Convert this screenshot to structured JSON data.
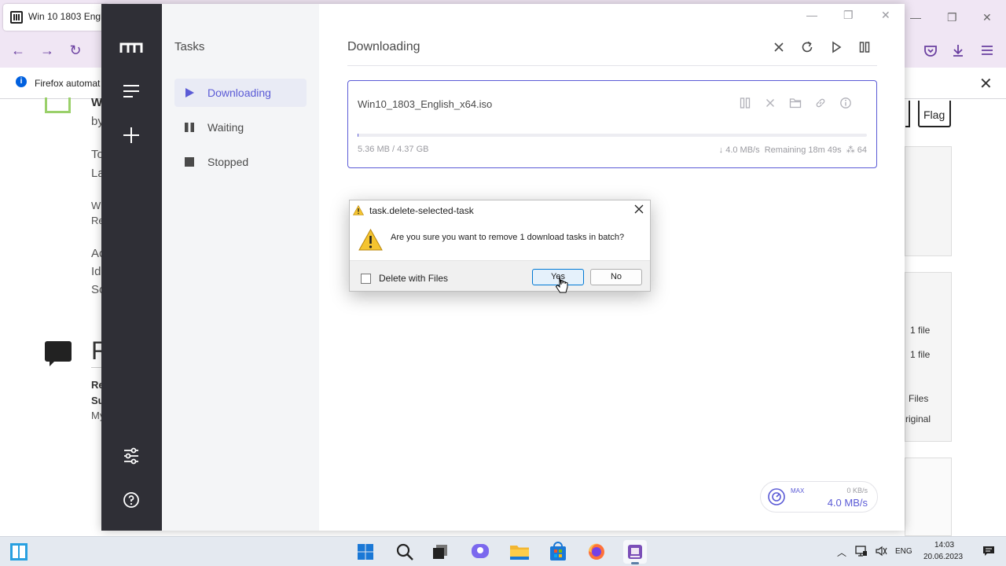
{
  "browser": {
    "tab_title": "Win 10 1803 English",
    "notification": "Firefox automat",
    "window_controls": [
      "—",
      "❐",
      "✕"
    ]
  },
  "page_behind": {
    "fragments_left": [
      "W",
      "by",
      "To",
      "La",
      "W",
      "Re",
      "Ac",
      "Id",
      "So"
    ],
    "heading_fragment": "R",
    "bold_fragments": [
      "Re",
      "Su"
    ],
    "my_fragment": "My",
    "flag_label": "Flag",
    "right_items": [
      "1 file",
      "1 file",
      "Files",
      "riginal"
    ]
  },
  "motrix": {
    "sidebar": {
      "title": "Tasks",
      "items": [
        {
          "label": "Downloading",
          "icon": "play-icon",
          "active": true
        },
        {
          "label": "Waiting",
          "icon": "pause-icon",
          "active": false
        },
        {
          "label": "Stopped",
          "icon": "stop-icon",
          "active": false
        }
      ]
    },
    "main_title": "Downloading",
    "header_actions": [
      "delete-all-icon",
      "refresh-icon",
      "resume-all-icon",
      "pause-all-icon"
    ],
    "task": {
      "name": "Win10_1803_English_x64.iso",
      "progress": 0.0012,
      "size": "5.36 MB / 4.37 GB",
      "speed": "↓ 4.0 MB/s",
      "remaining": "Remaining 18m 49s",
      "connections": "⁂ 64"
    },
    "speedometer": {
      "max_label": "MAX",
      "upload": "0 KB/s",
      "download": "4.0 MB/s"
    },
    "accent_color": "#5b5bd6"
  },
  "dialog": {
    "title": "task.delete-selected-task",
    "message": "Are you sure you want to remove 1 download tasks in batch?",
    "checkbox_label": "Delete with Files",
    "checkbox_checked": false,
    "yes_label": "Yes",
    "no_label": "No"
  },
  "taskbar": {
    "apps": [
      "start-icon",
      "search-icon",
      "task-view-icon",
      "chat-icon",
      "file-explorer-icon",
      "store-icon",
      "firefox-icon",
      "motrix-icon"
    ],
    "language": "ENG",
    "time": "14:03",
    "date": "20.06.2023"
  }
}
